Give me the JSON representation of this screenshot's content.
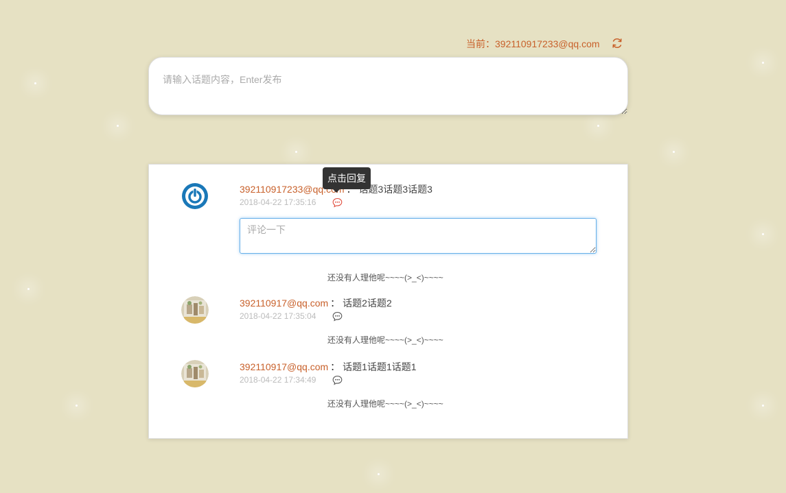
{
  "header": {
    "current_user_label": "当前：392110917233@qq.com",
    "refresh_icon": "refresh-icon"
  },
  "topic_input": {
    "placeholder": "请输入话题内容，Enter发布",
    "value": ""
  },
  "tooltip": {
    "text": "点击回复"
  },
  "topics": [
    {
      "author": "392110917233@qq.com",
      "separator": "：",
      "content": "话题3话题3话题3",
      "time": "2018-04-22 17:35:16",
      "avatar_icon": "power-logo-avatar",
      "reply_icon": "comment-bubble-icon",
      "reply_icon_color": "#e04c3c",
      "comment_placeholder": "评论一下",
      "no_reply_text": "还没有人理他呢~~~~(>_<)~~~~"
    },
    {
      "author": "392110917@qq.com",
      "separator": "：",
      "content": "话题2话题2",
      "time": "2018-04-22 17:35:04",
      "avatar_icon": "photo-avatar",
      "reply_icon": "comment-bubble-icon",
      "reply_icon_color": "#555555",
      "no_reply_text": "还没有人理他呢~~~~(>_<)~~~~"
    },
    {
      "author": "392110917@qq.com",
      "separator": "：",
      "content": "话题1话题1话题1",
      "time": "2018-04-22 17:34:49",
      "avatar_icon": "photo-avatar",
      "reply_icon": "comment-bubble-icon",
      "reply_icon_color": "#555555",
      "no_reply_text": "还没有人理他呢~~~~(>_<)~~~~"
    }
  ],
  "colors": {
    "background": "#e6e1c3",
    "accent": "#c8602a",
    "focus_border": "#66afe9"
  }
}
